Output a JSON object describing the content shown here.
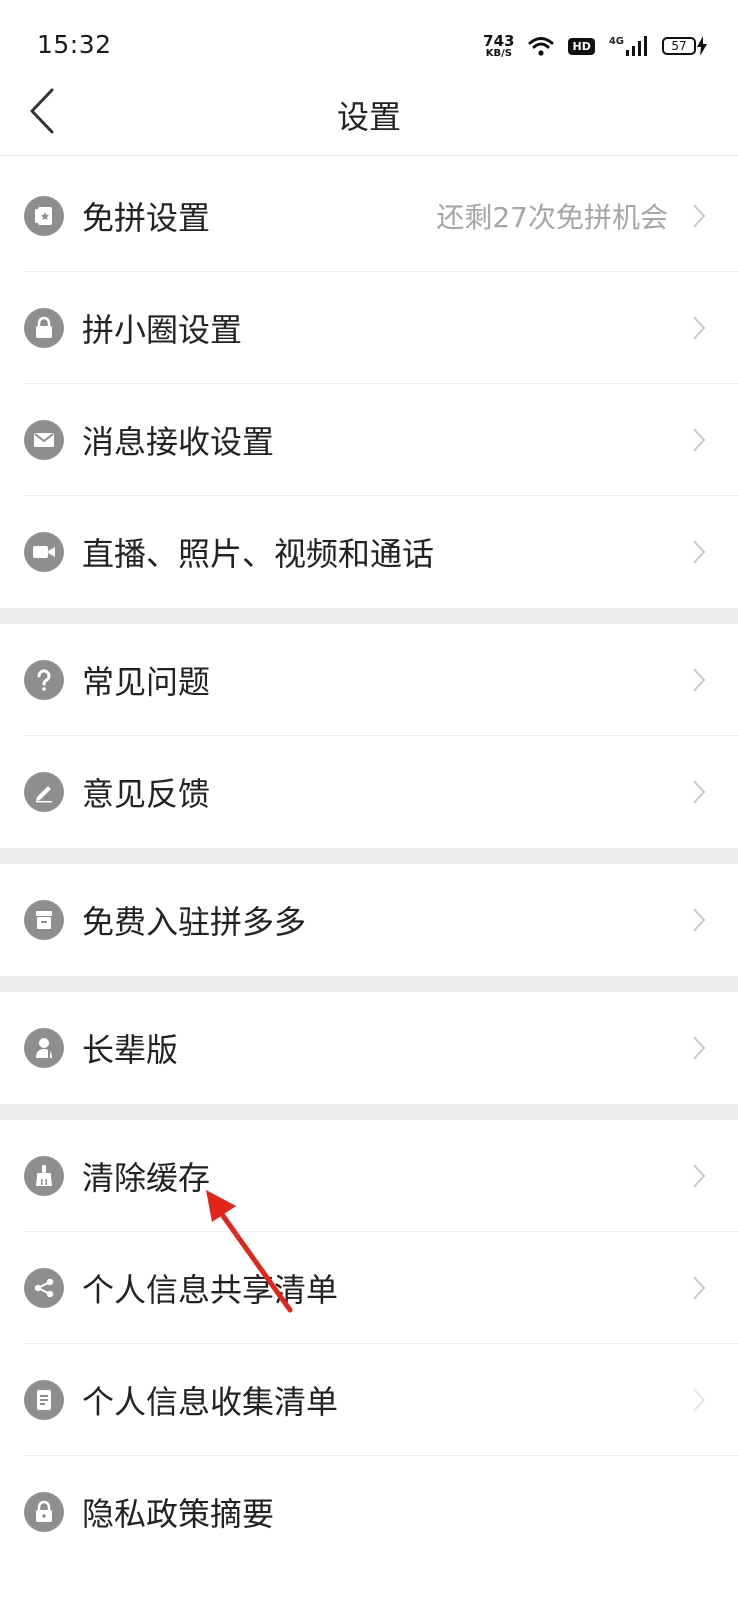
{
  "status_bar": {
    "time": "15:32",
    "net_speed_value": "743",
    "net_speed_unit": "KB/S",
    "hd": "HD",
    "signal": "4G",
    "battery": "57"
  },
  "nav": {
    "title": "设置",
    "back_icon": "chevron-left-icon"
  },
  "groups": [
    {
      "items": [
        {
          "icon": "card-star-icon",
          "label": "免拼设置",
          "extra": "还剩27次免拼机会"
        },
        {
          "icon": "lock-icon",
          "label": "拼小圈设置"
        },
        {
          "icon": "mail-icon",
          "label": "消息接收设置"
        },
        {
          "icon": "video-camera-icon",
          "label": "直播、照片、视频和通话"
        }
      ]
    },
    {
      "items": [
        {
          "icon": "question-icon",
          "label": "常见问题"
        },
        {
          "icon": "pencil-icon",
          "label": "意见反馈"
        }
      ]
    },
    {
      "items": [
        {
          "icon": "store-icon",
          "label": "免费入驻拼多多"
        }
      ]
    },
    {
      "items": [
        {
          "icon": "elder-icon",
          "label": "长辈版"
        }
      ]
    },
    {
      "items": [
        {
          "icon": "broom-icon",
          "label": "清除缓存"
        },
        {
          "icon": "share-icon",
          "label": "个人信息共享清单"
        },
        {
          "icon": "document-list-icon",
          "label": "个人信息收集清单"
        },
        {
          "icon": "lock-icon",
          "label": "隐私政策摘要"
        }
      ]
    }
  ],
  "colors": {
    "icon_bg": "#8e8e8e",
    "divider": "#ececec",
    "section_gap": "#ededed",
    "annotation_arrow": "#e0261b"
  }
}
